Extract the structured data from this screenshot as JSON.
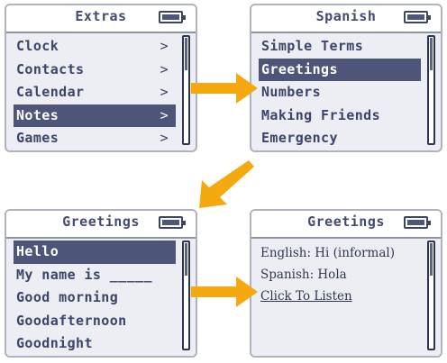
{
  "screens": {
    "extras": {
      "title": "Extras",
      "items": [
        {
          "label": "Clock",
          "arrow": ">"
        },
        {
          "label": "Contacts",
          "arrow": ">"
        },
        {
          "label": "Calendar",
          "arrow": ">"
        },
        {
          "label": "Notes",
          "arrow": ">",
          "selected": true
        },
        {
          "label": "Games",
          "arrow": ">"
        }
      ]
    },
    "spanish": {
      "title": "Spanish",
      "items": [
        {
          "label": "Simple Terms"
        },
        {
          "label": "Greetings",
          "selected": true
        },
        {
          "label": "Numbers"
        },
        {
          "label": "Making Friends"
        },
        {
          "label": "Emergency"
        }
      ]
    },
    "greetings_list": {
      "title": "Greetings",
      "items": [
        {
          "label": "Hello",
          "selected": true
        },
        {
          "label": "My name is _____"
        },
        {
          "label": "Good morning"
        },
        {
          "label": "Goodafternoon"
        },
        {
          "label": "Goodnight"
        }
      ]
    },
    "greetings_detail": {
      "title": "Greetings",
      "english": "English: Hi (informal)",
      "spanish": "Spanish: Hola",
      "listen": "Click To Listen"
    }
  },
  "colors": {
    "arrow": "#f5a910",
    "selection": "#4d5679",
    "text": "#3b456a"
  },
  "icons": [
    "battery-icon",
    "chevron-right-icon",
    "scrollbar",
    "arrow-right-icon",
    "arrow-down-left-icon"
  ]
}
